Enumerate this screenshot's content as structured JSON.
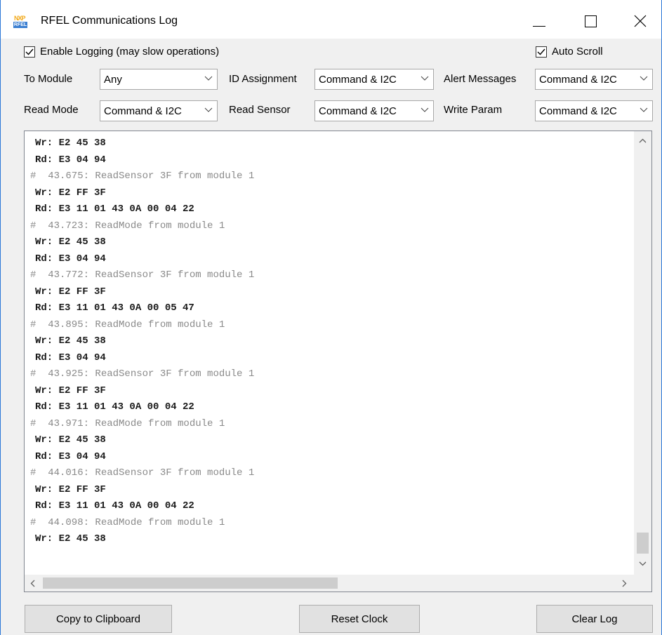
{
  "window": {
    "title": "RFEL Communications Log",
    "icon_top": "NXP",
    "icon_bottom": "RFEL"
  },
  "options": {
    "enable_logging": {
      "label": "Enable Logging (may slow operations)",
      "checked": true
    },
    "auto_scroll": {
      "label": "Auto Scroll",
      "checked": true
    }
  },
  "filters": {
    "to_module": {
      "label": "To Module",
      "value": "Any"
    },
    "id_assignment": {
      "label": "ID Assignment",
      "value": "Command & I2C"
    },
    "alert_messages": {
      "label": "Alert Messages",
      "value": "Command & I2C"
    },
    "read_mode": {
      "label": "Read Mode",
      "value": "Command & I2C"
    },
    "read_sensor": {
      "label": "Read Sensor",
      "value": "Command & I2C"
    },
    "write_param": {
      "label": "Write Param",
      "value": "Command & I2C"
    }
  },
  "log": {
    "lines": [
      {
        "text": "Wr: E2 45 38",
        "kind": "data"
      },
      {
        "text": "Rd: E3 04 94",
        "kind": "data"
      },
      {
        "text": "#  43.675: ReadSensor 3F from module 1",
        "kind": "comment"
      },
      {
        "text": "Wr: E2 FF 3F",
        "kind": "data"
      },
      {
        "text": "Rd: E3 11 01 43 0A 00 04 22",
        "kind": "data"
      },
      {
        "text": "#  43.723: ReadMode from module 1",
        "kind": "comment"
      },
      {
        "text": "Wr: E2 45 38",
        "kind": "data"
      },
      {
        "text": "Rd: E3 04 94",
        "kind": "data"
      },
      {
        "text": "#  43.772: ReadSensor 3F from module 1",
        "kind": "comment"
      },
      {
        "text": "Wr: E2 FF 3F",
        "kind": "data"
      },
      {
        "text": "Rd: E3 11 01 43 0A 00 05 47",
        "kind": "data"
      },
      {
        "text": "#  43.895: ReadMode from module 1",
        "kind": "comment"
      },
      {
        "text": "Wr: E2 45 38",
        "kind": "data"
      },
      {
        "text": "Rd: E3 04 94",
        "kind": "data"
      },
      {
        "text": "#  43.925: ReadSensor 3F from module 1",
        "kind": "comment"
      },
      {
        "text": "Wr: E2 FF 3F",
        "kind": "data"
      },
      {
        "text": "Rd: E3 11 01 43 0A 00 04 22",
        "kind": "data"
      },
      {
        "text": "#  43.971: ReadMode from module 1",
        "kind": "comment"
      },
      {
        "text": "Wr: E2 45 38",
        "kind": "data"
      },
      {
        "text": "Rd: E3 04 94",
        "kind": "data"
      },
      {
        "text": "#  44.016: ReadSensor 3F from module 1",
        "kind": "comment"
      },
      {
        "text": "Wr: E2 FF 3F",
        "kind": "data"
      },
      {
        "text": "Rd: E3 11 01 43 0A 00 04 22",
        "kind": "data"
      },
      {
        "text": "#  44.098: ReadMode from module 1",
        "kind": "comment"
      },
      {
        "text": "Wr: E2 45 38",
        "kind": "data"
      }
    ]
  },
  "buttons": {
    "copy": "Copy to Clipboard",
    "reset_clock": "Reset Clock",
    "clear_log": "Clear Log"
  }
}
